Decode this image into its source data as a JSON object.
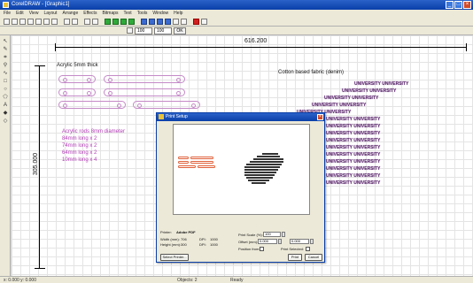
{
  "window": {
    "title": "CorelDRAW - [Graphic1]"
  },
  "menu": [
    "File",
    "Edit",
    "View",
    "Layout",
    "Arrange",
    "Effects",
    "Bitmaps",
    "Text",
    "Tools",
    "Window",
    "Help"
  ],
  "zoom": {
    "width_value": "100",
    "height_value": "100",
    "button": "OK"
  },
  "canvas": {
    "width_dim": "616.200",
    "height_dim": "305.000",
    "acrylic_label": "Acrylic 5mm thick",
    "rods": [
      "Acrylic rods 8mm diameter",
      "84mm long x 2",
      "74mm long x 2",
      "64mm long x 2",
      "10mm long x 4"
    ],
    "cotton_label": "Cotton based fabric (denim)",
    "fabric_word": "UNIVERSITY UNIVERSITY"
  },
  "dialog": {
    "title": "Print Setup",
    "printer_label": "Printer:",
    "printer_value": "Adobe PDF",
    "width_label": "Width (mm):",
    "width_value": "706",
    "height_label": "Height (mm):",
    "height_value": "300",
    "dpi_label": "DPI:",
    "dpi_value": "1000",
    "dpi2_value": "1000",
    "scale_label": "Print Scale (%):",
    "scale_value": "100",
    "offset_label": "Offset (mm):",
    "offset_x_value": "0.000",
    "offset_y_value": "0.000",
    "position_label": "Position from:",
    "print_selected_label": "Print Selected:",
    "select_printer_button": "Select Printer...",
    "print_button": "Print",
    "cancel_button": "Cancel"
  },
  "status": {
    "left": "x:  0.000  y:  0.000",
    "mid": "Objects: 2",
    "right": "Ready"
  }
}
